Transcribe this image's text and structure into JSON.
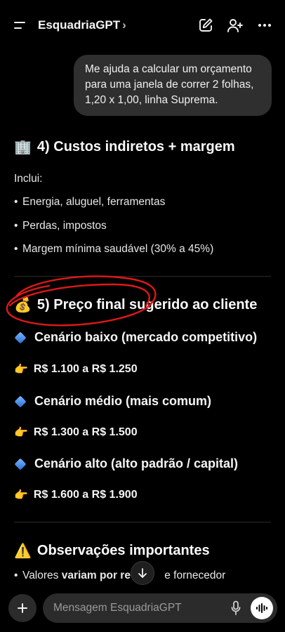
{
  "header": {
    "title": "EsquadriaGPT",
    "chevron": "›",
    "icons": [
      "menu-icon",
      "edit-icon",
      "add-person-icon",
      "more-icon"
    ]
  },
  "user_message": "Me ajuda a calcular um orçamento para uma janela de correr 2 folhas, 1,20 x 1,00, linha Suprema.",
  "section4": {
    "emoji": "🏢",
    "title": "4) Custos indiretos + margem",
    "intro": "Inclui:",
    "bullets": [
      "Energia, aluguel, ferramentas",
      "Perdas, impostos",
      "Margem mínima saudável (30% a 45%)"
    ]
  },
  "section5": {
    "emoji": "💰",
    "title": "5) Preço final sugerido ao cliente",
    "annotation_color": "#e01818",
    "scenarios": [
      {
        "label": "Cenário baixo (mercado competitivo)",
        "price": "R$ 1.100 a R$ 1.250"
      },
      {
        "label": "Cenário médio (mais comum)",
        "price": "R$ 1.300 a R$ 1.500"
      },
      {
        "label": "Cenário alto (alto padrão / capital)",
        "price": "R$ 1.600 a R$ 1.900"
      }
    ],
    "hand_emoji": "👉"
  },
  "section6": {
    "emoji": "⚠️",
    "title": "Observações importantes",
    "bullet_pre": "Valores ",
    "bullet_bold": "variam por re",
    "bullet_post": " e fornecedor"
  },
  "composer": {
    "placeholder": "Mensagem EsquadriaGPT",
    "icons": [
      "plus-icon",
      "mic-icon",
      "voice-icon",
      "scroll-down-icon"
    ]
  }
}
